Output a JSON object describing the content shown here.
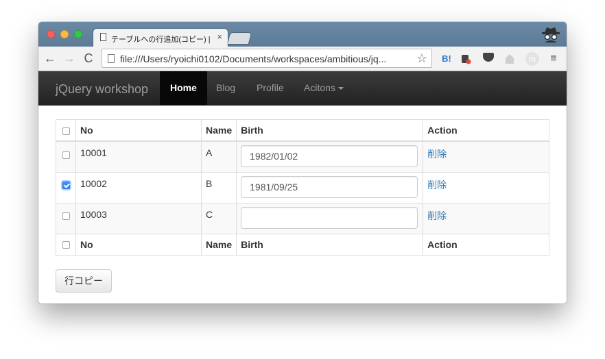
{
  "browser": {
    "tab_title": "テーブルへの行追加(コピー) | ...",
    "tab_close": "×",
    "url": "file:///Users/ryoichi0102/Documents/workspaces/ambitious/jq...",
    "nav_back": "←",
    "nav_forward": "→",
    "nav_reload": "C",
    "bookmark_star": "☆",
    "ext_hatena": "B!",
    "ext_m": "m",
    "menu": "≡"
  },
  "navbar": {
    "brand": "jQuery workshop",
    "items": [
      {
        "label": "Home",
        "active": true
      },
      {
        "label": "Blog",
        "active": false
      },
      {
        "label": "Profile",
        "active": false
      },
      {
        "label": "Acitons",
        "active": false,
        "dropdown": true
      }
    ]
  },
  "table": {
    "headers": {
      "no": "No",
      "name": "Name",
      "birth": "Birth",
      "action": "Action"
    },
    "footers": {
      "no": "No",
      "name": "Name",
      "birth": "Birth",
      "action": "Action"
    },
    "rows": [
      {
        "no": "10001",
        "name": "A",
        "birth": "1982/01/02",
        "action": "削除",
        "checked": false
      },
      {
        "no": "10002",
        "name": "B",
        "birth": "1981/09/25",
        "action": "削除",
        "checked": true
      },
      {
        "no": "10003",
        "name": "C",
        "birth": "",
        "action": "削除",
        "checked": false
      }
    ]
  },
  "copy_button": "行コピー"
}
